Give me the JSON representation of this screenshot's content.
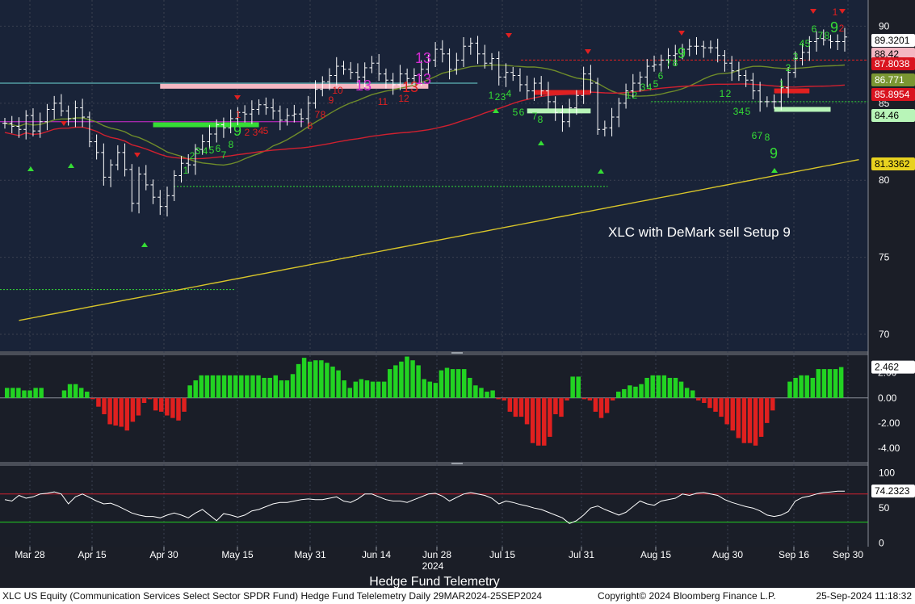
{
  "annotation": "XLC with DeMark sell Setup 9",
  "year_label": "2024",
  "source_label": "Hedge Fund Telemetry",
  "footer": {
    "left": "XLC US Equity (Communication Services Select Sector SPDR Fund) Hedge Fund Telelemetry  Daily 29MAR2024-25SEP2024",
    "copyright": "Copyright© 2024 Bloomberg Finance L.P.",
    "timestamp": "25-Sep-2024 11:18:32"
  },
  "colors": {
    "price_bg": "#192338",
    "osc_bg": "#1a1e28",
    "bars": "#ffffff",
    "ma_red": "#d0202f",
    "ma_olive": "#6f8c2a",
    "ma_yellow": "#d8c52a",
    "pos_hist": "#22d322",
    "neg_hist": "#e0201f",
    "rsi": "#ffffff",
    "magenta": "#d22bd2",
    "buy_green": "#35dd35",
    "sell_red": "#e02020"
  },
  "chart_data": [
    {
      "type": "candlestick",
      "panel": "price",
      "x_ticks": [
        "Mar 28",
        "Apr 15",
        "Apr 30",
        "May 15",
        "May 31",
        "Jun 14",
        "Jun 28",
        "Jul 15",
        "Jul 31",
        "Aug 15",
        "Aug 30",
        "Sep 16",
        "Sep 30"
      ],
      "y_ticks": [
        70,
        75,
        80,
        85,
        90
      ],
      "ylim": [
        68.9,
        91.7
      ],
      "price_labels": [
        {
          "value": 89.3201,
          "text": "89.3201",
          "bg": "#ffffff",
          "fg": "#000000"
        },
        {
          "value": 88.42,
          "text": "88.42",
          "bg": "#f4b7c2",
          "fg": "#000000"
        },
        {
          "value": 87.8038,
          "text": "87.8038",
          "bg": "#d9141f",
          "fg": "#ffffff"
        },
        {
          "value": 86.771,
          "text": "86.771",
          "bg": "#7a9632",
          "fg": "#ffffff"
        },
        {
          "value": 85.8954,
          "text": "85.8954",
          "bg": "#d9141f",
          "fg": "#ffffff"
        },
        {
          "value": 84.46,
          "text": "84.46",
          "bg": "#b8f5b8",
          "fg": "#000000"
        },
        {
          "value": 81.3362,
          "text": "81.3362",
          "bg": "#e8d21f",
          "fg": "#000000"
        }
      ],
      "series": [
        {
          "name": "close",
          "values": [
            83.7,
            83.5,
            83.3,
            84.2,
            83.2,
            83.8,
            84.6,
            85.0,
            84.5,
            84.0,
            84.7,
            84.1,
            82.5,
            81.8,
            80.2,
            81.0,
            81.8,
            80.7,
            78.5,
            80.4,
            79.7,
            78.9,
            78.3,
            79.0,
            80.3,
            81.1,
            81.0,
            82.0,
            82.5,
            83.0,
            83.6,
            83.4,
            84.0,
            84.4,
            84.3,
            84.6,
            84.9,
            84.7,
            84.5,
            83.9,
            84.2,
            84.3,
            84.0,
            85.0,
            85.9,
            86.4,
            86.8,
            87.4,
            87.2,
            87.0,
            86.7,
            87.3,
            87.6,
            86.9,
            86.5,
            86.2,
            86.9,
            86.6,
            86.8,
            87.2,
            87.8,
            88.5,
            88.2,
            87.2,
            87.8,
            88.7,
            88.9,
            88.2,
            87.6,
            87.9,
            86.7,
            87.0,
            86.8,
            86.2,
            85.8,
            86.3,
            85.8,
            85.1,
            84.4,
            83.8,
            84.7,
            85.5,
            86.9,
            86.3,
            83.3,
            83.4,
            84.1,
            85.0,
            85.8,
            86.3,
            86.7,
            87.4,
            87.5,
            87.8,
            88.1,
            88.2,
            88.5,
            88.7,
            88.7,
            88.6,
            88.6,
            88.1,
            87.6,
            87.1,
            86.8,
            86.5,
            85.8,
            85.1,
            85.1,
            85.1,
            86.0,
            87.0,
            87.9,
            88.3,
            89.0,
            89.2,
            89.1,
            89.0,
            89.0,
            89.3
          ]
        }
      ]
    },
    {
      "type": "bar",
      "panel": "oscillator",
      "y_ticks": [
        2.0,
        0.0,
        -2.0,
        -4.0
      ],
      "tick_labels": [
        "2.00",
        "0.00",
        "-2.00",
        "-4.00"
      ],
      "ylim": [
        -5.1,
        3.4
      ],
      "last_label": "2.462",
      "values": [
        0.8,
        0.8,
        0.8,
        0.6,
        0.6,
        0.8,
        0.8,
        0.0,
        0.0,
        0.0,
        0.6,
        1.1,
        1.1,
        0.8,
        0.5,
        -0.1,
        -0.7,
        -1.3,
        -2.1,
        -2.2,
        -2.3,
        -2.6,
        -1.9,
        -1.4,
        -0.4,
        -0.1,
        -1.0,
        -1.1,
        -1.4,
        -1.6,
        -1.8,
        -1.1,
        1.0,
        1.4,
        1.8,
        1.8,
        1.8,
        1.8,
        1.8,
        1.8,
        1.8,
        1.8,
        1.8,
        1.8,
        1.8,
        1.6,
        1.6,
        1.8,
        1.4,
        1.4,
        1.9,
        2.7,
        3.2,
        2.9,
        3.0,
        3.0,
        2.8,
        2.5,
        2.2,
        1.4,
        0.8,
        1.3,
        1.5,
        1.4,
        1.3,
        1.3,
        1.3,
        2.3,
        2.6,
        2.9,
        3.3,
        3.0,
        2.6,
        1.5,
        1.3,
        1.2,
        2.2,
        2.4,
        2.3,
        2.3,
        2.3,
        1.6,
        1.0,
        0.8,
        0.5,
        0.6,
        -0.1,
        -0.2,
        -1.1,
        -1.5,
        -1.5,
        -2.1,
        -3.6,
        -3.8,
        -3.8,
        -3.1,
        -1.3,
        -1.5,
        -0.2,
        1.7,
        1.7,
        -0.1,
        -0.2,
        -1.1,
        -1.6,
        -1.2,
        -0.2,
        0.5,
        0.7,
        1.0,
        0.9,
        1.1,
        1.6,
        1.8,
        1.8,
        1.8,
        1.6,
        1.6,
        1.3,
        0.8,
        0.6,
        -0.2,
        -0.4,
        -0.8,
        -1.1,
        -1.5,
        -2.1,
        -2.6,
        -3.2,
        -3.6,
        -3.6,
        -3.8,
        -3.1,
        -2.0,
        -1.0,
        0.0,
        0.0,
        1.3,
        1.6,
        1.8,
        1.8,
        1.6,
        2.3,
        2.3,
        2.3,
        2.3,
        2.46
      ]
    },
    {
      "type": "line",
      "panel": "rsi",
      "y_ticks": [
        0,
        50,
        100
      ],
      "ylim": [
        -5,
        110
      ],
      "levels": [
        70,
        30
      ],
      "last_label": "74.2323",
      "values": [
        62,
        60,
        68,
        64,
        66,
        70,
        71,
        73,
        70,
        56,
        66,
        70,
        65,
        60,
        56,
        57,
        53,
        48,
        43,
        40,
        38,
        38,
        36,
        40,
        43,
        40,
        36,
        43,
        48,
        40,
        32,
        42,
        40,
        37,
        40,
        46,
        48,
        52,
        56,
        58,
        58,
        60,
        62,
        63,
        62,
        62,
        64,
        66,
        60,
        58,
        63,
        70,
        70,
        66,
        62,
        60,
        60,
        58,
        62,
        66,
        70,
        71,
        67,
        60,
        65,
        70,
        72,
        70,
        68,
        64,
        56,
        60,
        58,
        55,
        53,
        50,
        48,
        44,
        40,
        36,
        28,
        32,
        40,
        50,
        53,
        48,
        44,
        40,
        44,
        52,
        60,
        56,
        54,
        60,
        62,
        64,
        70,
        68,
        71,
        72,
        70,
        68,
        62,
        58,
        55,
        52,
        50,
        46,
        40,
        38,
        40,
        45,
        60,
        65,
        67,
        70,
        72,
        73,
        74,
        74
      ]
    }
  ],
  "demark": {
    "sell_counts": [
      {
        "text": "1",
        "x": 295,
        "y": 146
      },
      {
        "text": "2",
        "x": 306,
        "y": 168
      },
      {
        "text": "3",
        "x": 316,
        "y": 168
      },
      {
        "text": "4",
        "x": 323,
        "y": 166
      },
      {
        "text": "5",
        "x": 329,
        "y": 166
      },
      {
        "text": "6",
        "x": 384,
        "y": 160
      },
      {
        "text": "7",
        "x": 393,
        "y": 146
      },
      {
        "text": "8",
        "x": 400,
        "y": 146
      },
      {
        "text": "9",
        "x": 410,
        "y": 128
      },
      {
        "text": "10",
        "x": 418,
        "y": 116
      },
      {
        "text": "11",
        "x": 474,
        "y": 130
      },
      {
        "text": "12",
        "x": 500,
        "y": 126
      },
      {
        "text": "1",
        "x": 1034,
        "y": 19
      },
      {
        "text": "2",
        "x": 1042,
        "y": 39
      }
    ],
    "buy_counts": [
      {
        "text": "1",
        "x": 230,
        "y": 215
      },
      {
        "text": "2",
        "x": 238,
        "y": 197
      },
      {
        "text": "3",
        "x": 245,
        "y": 191
      },
      {
        "text": "4",
        "x": 254,
        "y": 191
      },
      {
        "text": "5",
        "x": 262,
        "y": 190
      },
      {
        "text": "6",
        "x": 270,
        "y": 188
      },
      {
        "text": "7",
        "x": 277,
        "y": 196
      },
      {
        "text": "8",
        "x": 286,
        "y": 183
      },
      {
        "text": "1",
        "x": 608,
        "y": 122
      },
      {
        "text": "2",
        "x": 616,
        "y": 124
      },
      {
        "text": "3",
        "x": 623,
        "y": 124
      },
      {
        "text": "4",
        "x": 630,
        "y": 120
      },
      {
        "text": "5",
        "x": 638,
        "y": 143
      },
      {
        "text": "6",
        "x": 646,
        "y": 143
      },
      {
        "text": "7",
        "x": 662,
        "y": 148
      },
      {
        "text": "8",
        "x": 669,
        "y": 152
      },
      {
        "text": "1",
        "x": 778,
        "y": 122
      },
      {
        "text": "2",
        "x": 786,
        "y": 122
      },
      {
        "text": "3",
        "x": 796,
        "y": 112
      },
      {
        "text": "4",
        "x": 804,
        "y": 112
      },
      {
        "text": "5",
        "x": 812,
        "y": 108
      },
      {
        "text": "6",
        "x": 818,
        "y": 98
      },
      {
        "text": "7",
        "x": 828,
        "y": 82
      },
      {
        "text": "8",
        "x": 836,
        "y": 82
      },
      {
        "text": "1",
        "x": 894,
        "y": 120
      },
      {
        "text": "2",
        "x": 902,
        "y": 120
      },
      {
        "text": "3",
        "x": 911,
        "y": 142
      },
      {
        "text": "4",
        "x": 918,
        "y": 142
      },
      {
        "text": "5",
        "x": 926,
        "y": 142
      },
      {
        "text": "6",
        "x": 934,
        "y": 172
      },
      {
        "text": "7",
        "x": 941,
        "y": 172
      },
      {
        "text": "8",
        "x": 950,
        "y": 174
      },
      {
        "text": "1",
        "x": 968,
        "y": 108
      },
      {
        "text": "2",
        "x": 976,
        "y": 88
      },
      {
        "text": "3",
        "x": 985,
        "y": 74
      },
      {
        "text": "4",
        "x": 993,
        "y": 58
      },
      {
        "text": "5",
        "x": 1000,
        "y": 58
      },
      {
        "text": "6",
        "x": 1008,
        "y": 40
      },
      {
        "text": "7",
        "x": 1016,
        "y": 48
      },
      {
        "text": "8",
        "x": 1024,
        "y": 48
      }
    ],
    "setup_nines": [
      {
        "text": "9",
        "x": 294,
        "y": 168,
        "color": "#35dd35"
      },
      {
        "text": "9",
        "x": 844,
        "y": 72,
        "color": "#35dd35"
      },
      {
        "text": "9",
        "x": 958,
        "y": 196,
        "color": "#35dd35"
      },
      {
        "text": "9",
        "x": 1033,
        "y": 40,
        "color": "#35dd35"
      }
    ],
    "countdown_13s": [
      {
        "text": "13",
        "x": 450,
        "y": 112,
        "color": "#d22bd2"
      },
      {
        "text": "13",
        "x": 524,
        "y": 78,
        "color": "#d22bd2"
      },
      {
        "text": "13",
        "x": 508,
        "y": 114,
        "color": "#e02020"
      },
      {
        "text": "13",
        "x": 524,
        "y": 104,
        "color": "#d22bd2"
      }
    ]
  }
}
